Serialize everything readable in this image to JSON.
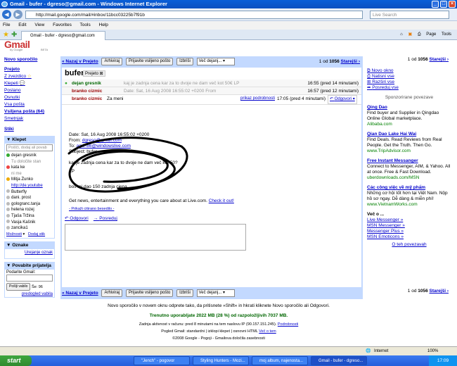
{
  "window": {
    "title": "Gmail - bufer - dgreso@gmail.com - Windows Internet Explorer",
    "url": "http://mail.google.com/mail/#inbox/11bcc03225b7f91b",
    "search_placeholder": "Live Search"
  },
  "menu": [
    "File",
    "Edit",
    "View",
    "Favorites",
    "Tools",
    "Help"
  ],
  "tab_label": "Gmail - bufer - dgreso@gmail.com",
  "tab_tools": [
    "Page",
    "Tools"
  ],
  "logo": {
    "text": "Gmail",
    "sub": "by Google",
    "badge": "BETA"
  },
  "nav": {
    "compose": "Novo sporočilo",
    "items": [
      "Prejeto",
      "Z zvezdico",
      "Klepeti",
      "Poslano",
      "Osnutki",
      "Vsa pošta",
      "Vsiljena pošta (64)",
      "Smetnjak"
    ],
    "contacts": "Stiki"
  },
  "chat": {
    "header": "Klepet",
    "search_placeholder": "Poišči, dodaj ali povab",
    "me": "dejan gresnik",
    "me_status": "Tu določite stan",
    "contacts": [
      "kata ke",
      "ni me",
      "Mitja Žunko",
      "http://de.youtube",
      "Butterfly",
      "dani. prost",
      "gologranc.tanja",
      "helena rozej",
      "Tjaša Tržina",
      "Vasja Kašnik",
      "zancika1"
    ],
    "options": "Možnosti",
    "add": "Dodaj stik"
  },
  "labels": {
    "header": "Oznake",
    "edit": "Urejanje oznak"
  },
  "invite": {
    "header": "Povabite prijatelja",
    "label": "Podarite Gmail:",
    "button": "Pošlji vabilo",
    "remaining": "Še: 96",
    "preview": "predogled vabila"
  },
  "actions": {
    "back": "« Nazaj v Prejeto",
    "archive": "Arhiviraj",
    "spam": "Prijavite vsiljeno pošto",
    "delete": "Izbriši",
    "more": "Več dejanj...",
    "count_prefix": "1 od",
    "count": "1056",
    "older": "Starejši ›"
  },
  "conversation": {
    "subject": "bufer",
    "label": "Prejeto",
    "messages": [
      {
        "sender": "dejan gresnik",
        "snippet": "kaj je zadnja cena kar za to dvoje ne dam več kot 50€ LP",
        "time": "16:55 (pred 14 minutami)"
      },
      {
        "sender": "branko cizmic",
        "snippet": "Date: Sat, 16 Aug 2008 16:55:02 +0200 From",
        "time": "16:57 (pred 12 minutami)"
      },
      {
        "sender": "branko cizmic",
        "snippet": "Za meni",
        "time": "17:05 (pred 4 minutami)",
        "details": "prikaz podrobnosti",
        "reply": "Odgovori"
      }
    ],
    "body": [
      "Date: Sat, 16 Aug 2008 16:55:02 +0200",
      "From: dgreso@gmail.com",
      "To: amir-86@windowslive.com",
      "Subject: bufer",
      "",
      "kaj je zadnja cena kar za to dvoje ne dam več kot 50?",
      "LP",
      "",
      "",
      "boš mi dao 150 zadnja cjena",
      "",
      "",
      "Get news, entertainment and everything you care about at Live.com. Check it out!"
    ],
    "quoted": "- Prikaži citirano besedilo -",
    "reply": "Odgovori",
    "forward": "Posreduj"
  },
  "right": {
    "links": [
      "Novo okno",
      "Natisni vse",
      "Razširi vse",
      "Posreduj vse"
    ],
    "sponsored": "Sponzorirane povezave",
    "ads": [
      {
        "title": "Qing Dao",
        "text": "Find buyer and Supplier in Qingdao Online Global marketplace.",
        "url": "Alibaba.com"
      },
      {
        "title": "Qian Dao Lake Hai Wai",
        "text": "Find Deals. Read Reviews from Real People. Get the Truth. Then Go.",
        "url": "www.TripAdvisor.com"
      },
      {
        "title": "Free Instant Messanger",
        "text": "Connect to Messenger, AIM, & Yahoo. All at once. Free & Fast Download.",
        "url": "uberdownloads.com/MSN"
      },
      {
        "title": "Các công việc về mỹ phẩm",
        "text": "Những cơ hội tốt hơn tại Việt Nam. Nộp hồ sơ ngay. Dễ dàng & miễn phí!",
        "url": "www.VietnamWorks.com"
      }
    ],
    "more_header": "Več o ...",
    "more": [
      "Live Messenger »",
      "MSN Messenger »",
      "Messenger Plus »",
      "MSN Emoticons »"
    ],
    "about": "O teh povezavah"
  },
  "footer": {
    "tip": "Novo sporočilo v novem oknu odprete tako, da pritisnete »Shift« in hkrati kliknete Novo sporočilo ali Odgovori.",
    "usage": "Trenutno uporabljate 2022 MB (28 %) od razpoložljivih 7037 MB.",
    "activity": "Zadnja aktivnost v računu: pred 8 minutami na tem naslovu IP (90.157.151.245).",
    "activity_link": "Podrobnosti",
    "view": "Pogled Gmail: standardni | izklopi klepet | osnovni HTML",
    "view_link": "Več o tem",
    "copyright": "©2008 Google - Pogoji - Gmailova določila zasebnosti"
  },
  "status": {
    "zone": "Internet",
    "zoom": "100%"
  },
  "taskbar": {
    "start": "start",
    "tasks": [
      "\"Jench\" - pogovor",
      "Styling Hunters - Mozi...",
      "moj album, najenosta...",
      "Gmail - bufer - dgreso..."
    ],
    "clock": "17:09"
  }
}
